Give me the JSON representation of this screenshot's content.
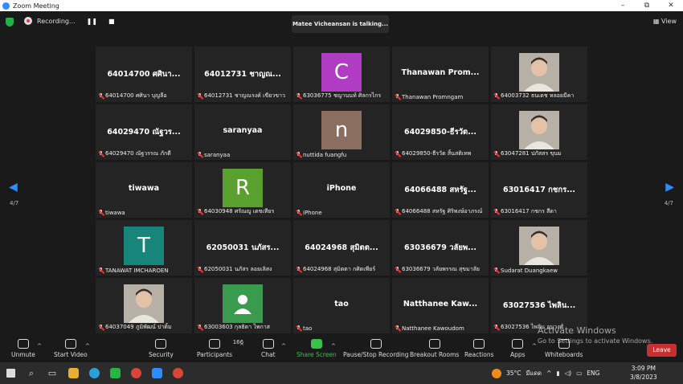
{
  "window": {
    "title": "Zoom Meeting",
    "min": "–",
    "max": "⧉",
    "close": "✕"
  },
  "top": {
    "recording": "Recording...",
    "pause": "❚❚",
    "stop": "■",
    "talking": "Matee Vicheansan is talking...",
    "view": "View"
  },
  "pager": {
    "left": "4/7",
    "right": "4/7"
  },
  "tiles": [
    {
      "kind": "name",
      "big": "64014700 ศศินา...",
      "label": "64014700 ศศินา บุญลือ"
    },
    {
      "kind": "name",
      "big": "64012731 ชาญณ...",
      "label": "64012731 ชาญณรงค์ เขียวขาว"
    },
    {
      "kind": "avatar",
      "letter": "C",
      "color": "#b03cc4",
      "label": "63036775 ชญานนท์ ศิลกรไกร"
    },
    {
      "kind": "name",
      "big": "Thanawan  Prom...",
      "label": "Thanawan Promngam"
    },
    {
      "kind": "photo",
      "label": "64003732 ธนเดช หลอยมีคา"
    },
    {
      "kind": "name",
      "big": "64029470 ณัฐวร...",
      "label": "64029470 ณัฐวรรณ ภักดี"
    },
    {
      "kind": "name",
      "big": "saranyaa",
      "label": "saranyaa"
    },
    {
      "kind": "avatar",
      "letter": "n",
      "color": "#8a6e60",
      "label": "nuttida fuangfu"
    },
    {
      "kind": "name",
      "big": "64029850-ธีรวัต...",
      "label": "64029850-ธีรวัต  สิ้นสติเทพ"
    },
    {
      "kind": "photo",
      "label": "63047281 ปภัสสร ขุนม"
    },
    {
      "kind": "name",
      "big": "tiwawa",
      "label": "tiwawa"
    },
    {
      "kind": "avatar",
      "letter": "R",
      "color": "#5aa02e",
      "label": "64030948 ศรัณญู เดชเทียร"
    },
    {
      "kind": "name",
      "big": "iPhone",
      "label": "iPhone"
    },
    {
      "kind": "name",
      "big": "64066488 สหรัฐ...",
      "label": "64066488 สหรัฐ ศิริพงษ์อาภรณ์"
    },
    {
      "kind": "name",
      "big": "63016417 กชกร...",
      "label": "63016417 กชกร สีดา"
    },
    {
      "kind": "avatar",
      "letter": "T",
      "color": "#17857a",
      "label": "TANAWAT IMCHAROEN"
    },
    {
      "kind": "name",
      "big": "62050031 นภัสร...",
      "label": "62050031 นภัสร ลอยเลิสง"
    },
    {
      "kind": "name",
      "big": "64024968 สุมิตต...",
      "label": "64024968 สุมิตตา กศิตเพียร์"
    },
    {
      "kind": "name",
      "big": "63036679 วลัยพ...",
      "label": "63036679 วลัยพรรณ สุขมาลัย"
    },
    {
      "kind": "photo",
      "label": "Sudarat Duangkaew"
    },
    {
      "kind": "photo",
      "label": "64037049 ภูมิพัฒน์ ปาดิ้ม"
    },
    {
      "kind": "user",
      "color": "#3a9a4e",
      "label": "63003603 กุลธิดา ไพกาส"
    },
    {
      "kind": "name",
      "big": "tao",
      "label": "tao"
    },
    {
      "kind": "name",
      "big": "Natthanee  Kaw...",
      "label": "Natthanee Kawoudom"
    },
    {
      "kind": "name",
      "big": "63027536 ไพลิน...",
      "label": "63027536 ไพลิน อนุวงศ์"
    }
  ],
  "toolbar": {
    "unmute": "Unmute",
    "start_video": "Start Video",
    "security": "Security",
    "participants": "Participants",
    "participants_count": "166",
    "chat": "Chat",
    "share": "Share Screen",
    "record": "Pause/Stop Recording",
    "breakout": "Breakout Rooms",
    "reactions": "Reactions",
    "apps": "Apps",
    "whiteboards": "Whiteboards",
    "leave": "Leave"
  },
  "watermark": {
    "line1": "Activate Windows",
    "line2": "Go to Settings to activate Windows."
  },
  "taskbar": {
    "temp": "35°C",
    "weather": "มีแดด",
    "lang": "ENG",
    "time": "3:09 PM",
    "date": "3/8/2023"
  }
}
